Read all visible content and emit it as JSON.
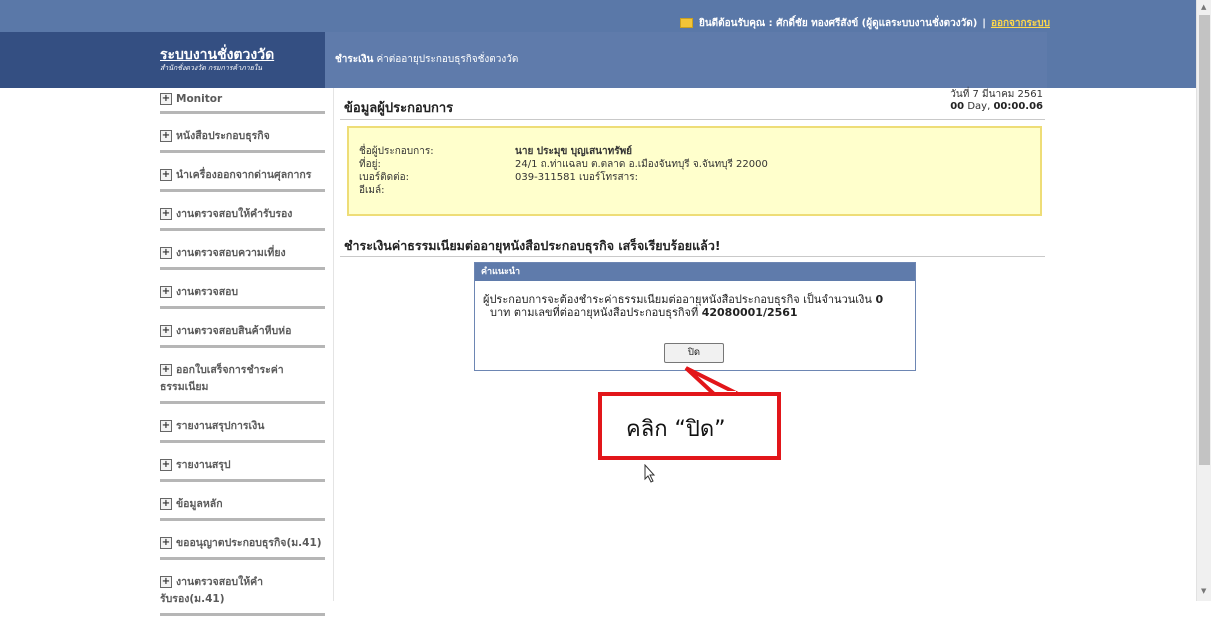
{
  "header": {
    "welcome_text": "ยินดีต้อนรับคุณ : ศักดิ์ชัย ทองศรีสังข์ (ผู้ดูแลระบบงานชั่งตวงวัด)",
    "separator": "|",
    "logout_label": "ออกจากระบบ",
    "icon": "mail-icon"
  },
  "brand": {
    "title": "ระบบงานชั่งตวงวัด",
    "subtitle": "สำนักชั่งตวงวัด กรมการค้าภายใน"
  },
  "breadcrumb": {
    "section": "ชำระเงิน",
    "page": "ค่าต่ออายุประกอบธุรกิจชั่งตวงวัด"
  },
  "sidebar": {
    "items": [
      {
        "label": "Monitor"
      },
      {
        "label": "หนังสือประกอบธุรกิจ"
      },
      {
        "label": "นำเครื่องออกจากด่านศุลกากร"
      },
      {
        "label": "งานตรวจสอบให้คำรับรอง"
      },
      {
        "label": "งานตรวจสอบความเที่ยง"
      },
      {
        "label": "งานตรวจสอบ"
      },
      {
        "label": "งานตรวจสอบสินค้าหีบห่อ"
      },
      {
        "label": "ออกใบเสร็จการชำระค่าธรรมเนียม"
      },
      {
        "label": "รายงานสรุปการเงิน"
      },
      {
        "label": "รายงานสรุป"
      },
      {
        "label": "ข้อมูลหลัก"
      },
      {
        "label": "ขออนุญาตประกอบธุรกิจ(ม.41)"
      },
      {
        "label": "งานตรวจสอบให้คำรับรอง(ม.41)"
      }
    ]
  },
  "datetime": {
    "date": "วันที่ 7 มีนาคม 2561",
    "duration_day": "00",
    "duration_day_unit": "Day,",
    "duration_time": "00:00.06"
  },
  "main": {
    "section_title": "ข้อมูลผู้ประกอบการ",
    "operator": {
      "name_label": "ชื่อผู้ประกอบการ:",
      "name_value": "นาย ประมุข บุญเสนาทรัพย์",
      "address_label": "ที่อยู่:",
      "address_value": "24/1 ถ.ท่าแฉลบ ต.ตลาด อ.เมืองจันทบุรี จ.จันทบุรี 22000",
      "phone_label": "เบอร์ติดต่อ:",
      "phone_value": "039-311581 เบอร์โทรสาร:",
      "email_label": "อีเมล์:"
    },
    "success_message": "ชำระเงินค่าธรรมเนียมต่ออายุหนังสือประกอบธุรกิจ เสร็จเรียบร้อยแล้ว!"
  },
  "dialog": {
    "title": "คำแนะนำ",
    "message_part1": "ผู้ประกอบการจะต้องชำระค่าธรรมเนียมต่ออายุหนังสือประกอบธุรกิจ เป็นจำนวนเงิน",
    "amount": "0",
    "message_part2": "บาท ตามเลขที่ต่ออายุหนังสือประกอบธุรกิจที่",
    "license_no": "42080001/2561",
    "close_label": "ปิด"
  },
  "annotation": {
    "callout_text": "คลิก “ปิด”",
    "color": "#e2161a"
  }
}
